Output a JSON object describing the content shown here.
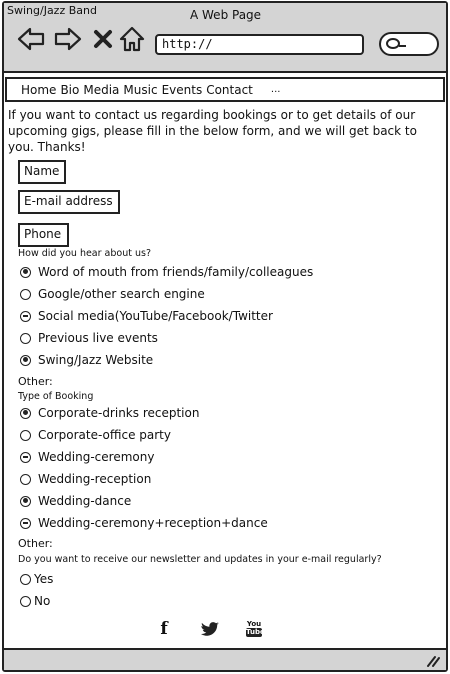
{
  "window": {
    "title": "Swing/Jazz Band",
    "page_title": "A Web Page",
    "url": "http://"
  },
  "nav": {
    "items": [
      "Home",
      "Bio",
      "Media",
      "Music",
      "Events",
      "Contact"
    ],
    "more": "..."
  },
  "intro": "If you want to contact us regarding bookings or to get details of our upcoming gigs, please fill in the below form, and we will get back to you. Thanks!",
  "fields": {
    "name": "Name",
    "email": "E-mail address",
    "phone": "Phone"
  },
  "hear_about": {
    "question": "How did you hear about us?",
    "options": [
      {
        "label": "Word of mouth from friends/family/colleagues",
        "state": "checked"
      },
      {
        "label": "Google/other search engine",
        "state": "unchecked"
      },
      {
        "label": "Social media(YouTube/Facebook/Twitter",
        "state": "partial"
      },
      {
        "label": "Previous live events",
        "state": "unchecked"
      },
      {
        "label": "Swing/Jazz Website",
        "state": "checked"
      }
    ],
    "other": "Other:"
  },
  "booking": {
    "question": "Type of Booking",
    "options": [
      {
        "label": "Corporate-drinks reception",
        "state": "checked"
      },
      {
        "label": "Corporate-office party",
        "state": "unchecked"
      },
      {
        "label": "Wedding-ceremony",
        "state": "partial"
      },
      {
        "label": "Wedding-reception",
        "state": "unchecked"
      },
      {
        "label": "Wedding-dance",
        "state": "checked"
      },
      {
        "label": "Wedding-ceremony+reception+dance",
        "state": "partial"
      }
    ],
    "other": "Other:"
  },
  "newsletter": {
    "question": "Do you want to receive our newsletter and updates in your e-mail regularly?",
    "options": [
      {
        "label": "Yes",
        "state": "unchecked"
      },
      {
        "label": "No",
        "state": "unchecked"
      }
    ]
  },
  "social": {
    "facebook": "f",
    "youtube_top": "You",
    "youtube_bottom": "Tube"
  }
}
